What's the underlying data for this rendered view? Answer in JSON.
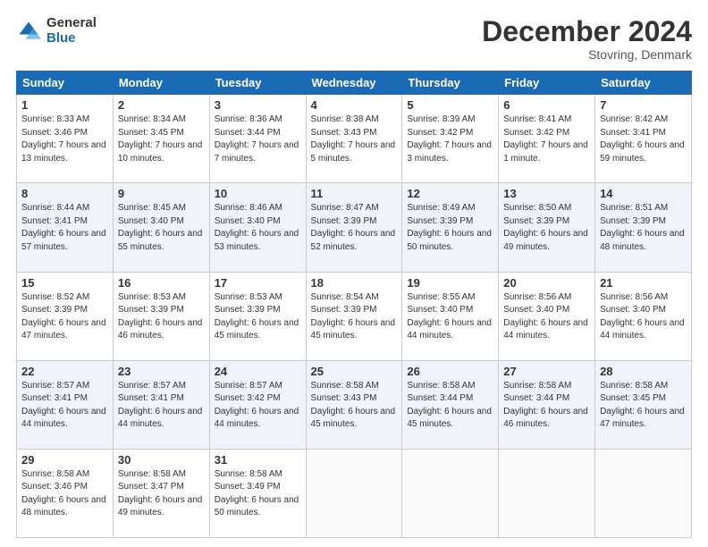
{
  "header": {
    "logo_general": "General",
    "logo_blue": "Blue",
    "month_title": "December 2024",
    "location": "Stovring, Denmark"
  },
  "days_of_week": [
    "Sunday",
    "Monday",
    "Tuesday",
    "Wednesday",
    "Thursday",
    "Friday",
    "Saturday"
  ],
  "weeks": [
    [
      {
        "day": 1,
        "sunrise": "8:33 AM",
        "sunset": "3:46 PM",
        "daylight": "7 hours and 13 minutes."
      },
      {
        "day": 2,
        "sunrise": "8:34 AM",
        "sunset": "3:45 PM",
        "daylight": "7 hours and 10 minutes."
      },
      {
        "day": 3,
        "sunrise": "8:36 AM",
        "sunset": "3:44 PM",
        "daylight": "7 hours and 7 minutes."
      },
      {
        "day": 4,
        "sunrise": "8:38 AM",
        "sunset": "3:43 PM",
        "daylight": "7 hours and 5 minutes."
      },
      {
        "day": 5,
        "sunrise": "8:39 AM",
        "sunset": "3:42 PM",
        "daylight": "7 hours and 3 minutes."
      },
      {
        "day": 6,
        "sunrise": "8:41 AM",
        "sunset": "3:42 PM",
        "daylight": "7 hours and 1 minute."
      },
      {
        "day": 7,
        "sunrise": "8:42 AM",
        "sunset": "3:41 PM",
        "daylight": "6 hours and 59 minutes."
      }
    ],
    [
      {
        "day": 8,
        "sunrise": "8:44 AM",
        "sunset": "3:41 PM",
        "daylight": "6 hours and 57 minutes."
      },
      {
        "day": 9,
        "sunrise": "8:45 AM",
        "sunset": "3:40 PM",
        "daylight": "6 hours and 55 minutes."
      },
      {
        "day": 10,
        "sunrise": "8:46 AM",
        "sunset": "3:40 PM",
        "daylight": "6 hours and 53 minutes."
      },
      {
        "day": 11,
        "sunrise": "8:47 AM",
        "sunset": "3:39 PM",
        "daylight": "6 hours and 52 minutes."
      },
      {
        "day": 12,
        "sunrise": "8:49 AM",
        "sunset": "3:39 PM",
        "daylight": "6 hours and 50 minutes."
      },
      {
        "day": 13,
        "sunrise": "8:50 AM",
        "sunset": "3:39 PM",
        "daylight": "6 hours and 49 minutes."
      },
      {
        "day": 14,
        "sunrise": "8:51 AM",
        "sunset": "3:39 PM",
        "daylight": "6 hours and 48 minutes."
      }
    ],
    [
      {
        "day": 15,
        "sunrise": "8:52 AM",
        "sunset": "3:39 PM",
        "daylight": "6 hours and 47 minutes."
      },
      {
        "day": 16,
        "sunrise": "8:53 AM",
        "sunset": "3:39 PM",
        "daylight": "6 hours and 46 minutes."
      },
      {
        "day": 17,
        "sunrise": "8:53 AM",
        "sunset": "3:39 PM",
        "daylight": "6 hours and 45 minutes."
      },
      {
        "day": 18,
        "sunrise": "8:54 AM",
        "sunset": "3:39 PM",
        "daylight": "6 hours and 45 minutes."
      },
      {
        "day": 19,
        "sunrise": "8:55 AM",
        "sunset": "3:40 PM",
        "daylight": "6 hours and 44 minutes."
      },
      {
        "day": 20,
        "sunrise": "8:56 AM",
        "sunset": "3:40 PM",
        "daylight": "6 hours and 44 minutes."
      },
      {
        "day": 21,
        "sunrise": "8:56 AM",
        "sunset": "3:40 PM",
        "daylight": "6 hours and 44 minutes."
      }
    ],
    [
      {
        "day": 22,
        "sunrise": "8:57 AM",
        "sunset": "3:41 PM",
        "daylight": "6 hours and 44 minutes."
      },
      {
        "day": 23,
        "sunrise": "8:57 AM",
        "sunset": "3:41 PM",
        "daylight": "6 hours and 44 minutes."
      },
      {
        "day": 24,
        "sunrise": "8:57 AM",
        "sunset": "3:42 PM",
        "daylight": "6 hours and 44 minutes."
      },
      {
        "day": 25,
        "sunrise": "8:58 AM",
        "sunset": "3:43 PM",
        "daylight": "6 hours and 45 minutes."
      },
      {
        "day": 26,
        "sunrise": "8:58 AM",
        "sunset": "3:44 PM",
        "daylight": "6 hours and 45 minutes."
      },
      {
        "day": 27,
        "sunrise": "8:58 AM",
        "sunset": "3:44 PM",
        "daylight": "6 hours and 46 minutes."
      },
      {
        "day": 28,
        "sunrise": "8:58 AM",
        "sunset": "3:45 PM",
        "daylight": "6 hours and 47 minutes."
      }
    ],
    [
      {
        "day": 29,
        "sunrise": "8:58 AM",
        "sunset": "3:46 PM",
        "daylight": "6 hours and 48 minutes."
      },
      {
        "day": 30,
        "sunrise": "8:58 AM",
        "sunset": "3:47 PM",
        "daylight": "6 hours and 49 minutes."
      },
      {
        "day": 31,
        "sunrise": "8:58 AM",
        "sunset": "3:49 PM",
        "daylight": "6 hours and 50 minutes."
      },
      null,
      null,
      null,
      null
    ]
  ]
}
